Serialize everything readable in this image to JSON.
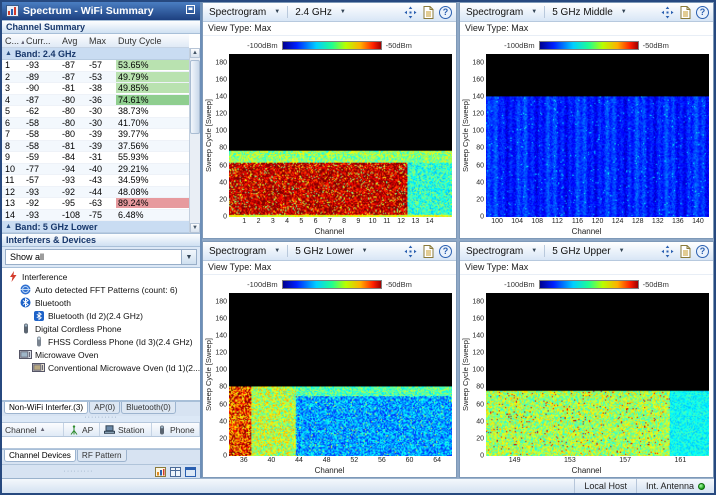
{
  "window": {
    "title": "Spectrum - WiFi Summary"
  },
  "statusbar": {
    "host": "Local Host",
    "antenna": "Int. Antenna"
  },
  "sidebar": {
    "channel_summary": {
      "title": "Channel Summary",
      "columns": {
        "channel": "C...",
        "current": "Curr...",
        "avg": "Avg",
        "max": "Max",
        "duty": "Duty Cycle"
      },
      "band_24_label": "Band:  2.4 GHz",
      "band_5_label": "Band:  5 GHz Lower",
      "rows": [
        {
          "ch": "1",
          "curr": "-93",
          "avg": "-87",
          "max": "-57",
          "duty": "53.65%",
          "hl": "green-light"
        },
        {
          "ch": "2",
          "curr": "-89",
          "avg": "-87",
          "max": "-53",
          "duty": "49.79%",
          "hl": "green-light"
        },
        {
          "ch": "3",
          "curr": "-90",
          "avg": "-81",
          "max": "-38",
          "duty": "49.85%",
          "hl": "green-light"
        },
        {
          "ch": "4",
          "curr": "-87",
          "avg": "-80",
          "max": "-36",
          "duty": "74.61%",
          "hl": "green"
        },
        {
          "ch": "5",
          "curr": "-62",
          "avg": "-80",
          "max": "-30",
          "duty": "38.73%",
          "hl": "none"
        },
        {
          "ch": "6",
          "curr": "-58",
          "avg": "-80",
          "max": "-30",
          "duty": "41.70%",
          "hl": "none"
        },
        {
          "ch": "7",
          "curr": "-58",
          "avg": "-80",
          "max": "-39",
          "duty": "39.77%",
          "hl": "none"
        },
        {
          "ch": "8",
          "curr": "-58",
          "avg": "-81",
          "max": "-39",
          "duty": "37.56%",
          "hl": "none"
        },
        {
          "ch": "9",
          "curr": "-59",
          "avg": "-84",
          "max": "-31",
          "duty": "55.93%",
          "hl": "none"
        },
        {
          "ch": "10",
          "curr": "-77",
          "avg": "-94",
          "max": "-40",
          "duty": "29.21%",
          "hl": "none"
        },
        {
          "ch": "11",
          "curr": "-57",
          "avg": "-93",
          "max": "-43",
          "duty": "34.59%",
          "hl": "none"
        },
        {
          "ch": "12",
          "curr": "-93",
          "avg": "-92",
          "max": "-44",
          "duty": "48.08%",
          "hl": "none"
        },
        {
          "ch": "13",
          "curr": "-92",
          "avg": "-95",
          "max": "-63",
          "duty": "89.24%",
          "hl": "red"
        },
        {
          "ch": "14",
          "curr": "-93",
          "avg": "-108",
          "max": "-75",
          "duty": "6.48%",
          "hl": "none"
        }
      ]
    },
    "interferers": {
      "title": "Interferers & Devices",
      "filter_value": "Show all",
      "tree": [
        {
          "label": "Interference",
          "depth": 0,
          "icon": "interference-icon"
        },
        {
          "label": "Auto detected FFT Patterns (count: 6)",
          "depth": 1,
          "icon": "fft-icon"
        },
        {
          "label": "Bluetooth",
          "depth": 1,
          "icon": "bluetooth-icon"
        },
        {
          "label": "Bluetooth (Id 2)(2.4 GHz)",
          "depth": 2,
          "icon": "bluetooth-device-icon"
        },
        {
          "label": "Digital Cordless Phone",
          "depth": 1,
          "icon": "cordless-phone-icon"
        },
        {
          "label": "FHSS Cordless Phone (Id 3)(2.4 GHz)",
          "depth": 2,
          "icon": "fhss-phone-icon"
        },
        {
          "label": "Microwave Oven",
          "depth": 1,
          "icon": "microwave-icon"
        },
        {
          "label": "Conventional Microwave Oven (Id 1)(2...",
          "depth": 2,
          "icon": "microwave-device-icon"
        }
      ],
      "tabs": {
        "items": [
          "Non-WiFi Interfer.(3)",
          "AP(0)",
          "Bluetooth(0)"
        ],
        "active": 0
      }
    },
    "devices": {
      "columns": [
        {
          "label": "Channel",
          "icon": "",
          "sort": "▲"
        },
        {
          "label": "AP",
          "icon": "ap-icon",
          "sort": ""
        },
        {
          "label": "Station",
          "icon": "station-icon",
          "sort": ""
        },
        {
          "label": "Phone",
          "icon": "phone-icon",
          "sort": ""
        }
      ],
      "tabs": {
        "items": [
          "Channel Devices",
          "RF Pattern"
        ],
        "active": 0
      }
    }
  },
  "panels": [
    {
      "type_label": "Spectrogram",
      "band": "2.4 GHz",
      "view_type": "View Type:  Max",
      "colorbar_min": "-100dBm",
      "colorbar_max": "-50dBm",
      "ylabel": "Sweep Cycle [Sweep]",
      "xlabel": "Channel",
      "ymax": 190,
      "yticks": [
        0,
        20,
        40,
        60,
        80,
        100,
        120,
        140,
        160,
        180
      ],
      "xticks": [
        1,
        2,
        3,
        4,
        5,
        6,
        7,
        8,
        9,
        10,
        11,
        12,
        13,
        14
      ],
      "xrange": [
        0,
        15.5
      ],
      "heatmap": {
        "profile": "wifi24",
        "fill": 0.41,
        "seed": 7
      }
    },
    {
      "type_label": "Spectrogram",
      "band": "5 GHz Middle",
      "view_type": "View Type:  Max",
      "colorbar_min": "-100dBm",
      "colorbar_max": "-50dBm",
      "ylabel": "Sweep Cycle [Sweep]",
      "xlabel": "Channel",
      "ymax": 190,
      "yticks": [
        0,
        20,
        40,
        60,
        80,
        100,
        120,
        140,
        160,
        180
      ],
      "xticks": [
        100,
        104,
        108,
        112,
        116,
        120,
        124,
        128,
        132,
        136,
        140
      ],
      "xrange": [
        98,
        142
      ],
      "heatmap": {
        "profile": "mid5",
        "fill": 0.74,
        "seed": 11
      }
    },
    {
      "type_label": "Spectrogram",
      "band": "5 GHz Lower",
      "view_type": "View Type:  Max",
      "colorbar_min": "-100dBm",
      "colorbar_max": "-50dBm",
      "ylabel": "Sweep Cycle [Sweep]",
      "xlabel": "Channel",
      "ymax": 190,
      "yticks": [
        0,
        20,
        40,
        60,
        80,
        100,
        120,
        140,
        160,
        180
      ],
      "xticks": [
        36,
        40,
        44,
        48,
        52,
        56,
        60,
        64
      ],
      "xrange": [
        34,
        66
      ],
      "heatmap": {
        "profile": "low5",
        "fill": 0.43,
        "seed": 23
      }
    },
    {
      "type_label": "Spectrogram",
      "band": "5 GHz Upper",
      "view_type": "View Type:  Max",
      "colorbar_min": "-100dBm",
      "colorbar_max": "-50dBm",
      "ylabel": "Sweep Cycle [Sweep]",
      "xlabel": "Channel",
      "ymax": 190,
      "yticks": [
        0,
        20,
        40,
        60,
        80,
        100,
        120,
        140,
        160,
        180
      ],
      "xticks": [
        149,
        153,
        157,
        161
      ],
      "xrange": [
        147,
        163
      ],
      "heatmap": {
        "profile": "up5",
        "fill": 0.4,
        "seed": 31
      }
    }
  ]
}
